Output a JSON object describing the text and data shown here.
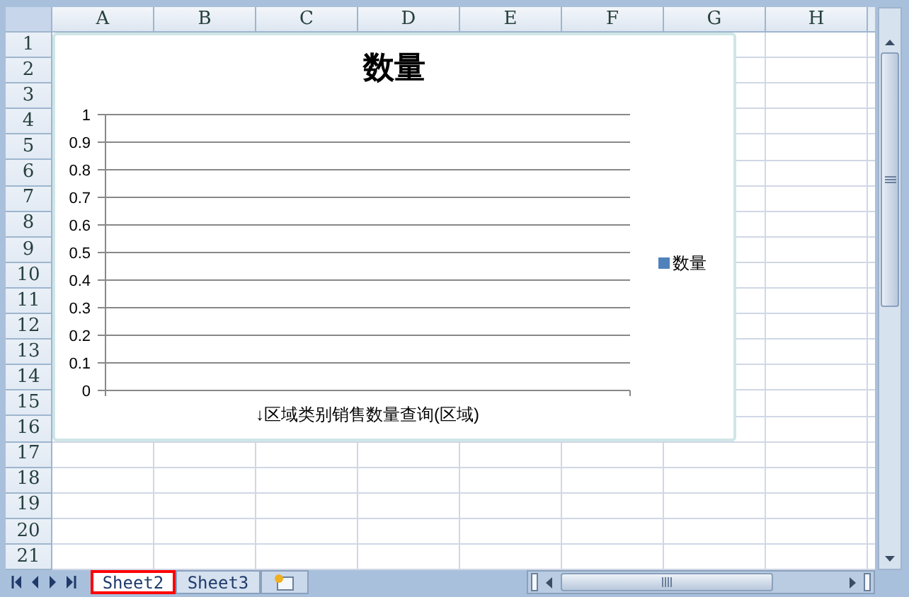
{
  "columns": [
    "A",
    "B",
    "C",
    "D",
    "E",
    "F",
    "G",
    "H"
  ],
  "rows": [
    "1",
    "2",
    "3",
    "4",
    "5",
    "6",
    "7",
    "8",
    "9",
    "10",
    "11",
    "12",
    "13",
    "14",
    "15",
    "16",
    "17",
    "18",
    "19",
    "20",
    "21"
  ],
  "chart": {
    "chart_data": {
      "type": "bar",
      "grid": true,
      "title": "数量",
      "xlabel": "↓区域类别销售数量查询(区域)",
      "ylim": [
        0,
        1
      ],
      "yticks": [
        {
          "value": 0,
          "label": "0"
        },
        {
          "value": 0.1,
          "label": "0.1"
        },
        {
          "value": 0.2,
          "label": "0.2"
        },
        {
          "value": 0.3,
          "label": "0.3"
        },
        {
          "value": 0.4,
          "label": "0.4"
        },
        {
          "value": 0.5,
          "label": "0.5"
        },
        {
          "value": 0.6,
          "label": "0.6"
        },
        {
          "value": 0.7,
          "label": "0.7"
        },
        {
          "value": 0.8,
          "label": "0.8"
        },
        {
          "value": 0.9,
          "label": "0.9"
        },
        {
          "value": 1,
          "label": "1"
        }
      ],
      "series": [
        {
          "name": "数量",
          "color": "#4f81bd"
        }
      ]
    }
  },
  "sheet_tabs": [
    {
      "label": "Sheet2",
      "selected": true,
      "highlighted": true
    },
    {
      "label": "Sheet3",
      "selected": false,
      "highlighted": false
    }
  ]
}
